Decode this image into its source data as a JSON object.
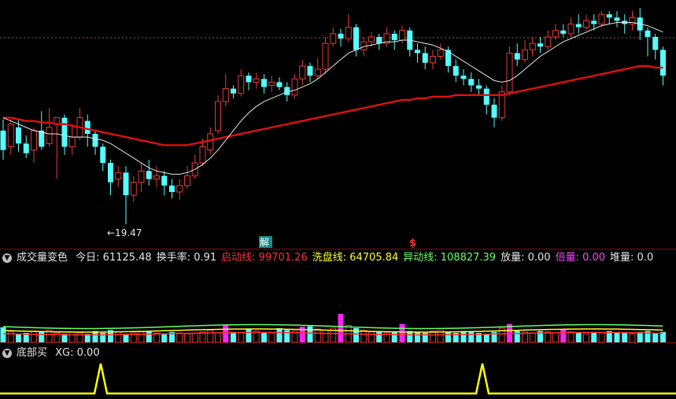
{
  "main_chart": {
    "min_price_label": "←19.47",
    "signal_jie": "解",
    "signal_s": "$"
  },
  "volume_panel": {
    "title": "成交量变色",
    "items": [
      {
        "label": "今日:",
        "value": "61125.48",
        "color": "#e6e6e6"
      },
      {
        "label": "换手率:",
        "value": "0.91",
        "color": "#e6e6e6"
      },
      {
        "label": "启动线:",
        "value": "99701.26",
        "color": "#ff3030"
      },
      {
        "label": "洗盘线:",
        "value": "64705.84",
        "color": "#ffff33"
      },
      {
        "label": "异动线:",
        "value": "108827.39",
        "color": "#66ff66"
      },
      {
        "label": "放量:",
        "value": "0.00",
        "color": "#e6e6e6"
      },
      {
        "label": "倍量:",
        "value": "0.00",
        "color": "#ff44ff"
      },
      {
        "label": "堆量:",
        "value": "0.0",
        "color": "#e6e6e6"
      }
    ]
  },
  "bottom_panel": {
    "title": "底部买",
    "xg_label": "XG: 0.00"
  },
  "colors": {
    "up": "#e83a3a",
    "down": "#54ffff",
    "ma_long": "#e01010",
    "ma_short": "#e6e6e6",
    "signal": "#ffff00"
  },
  "chart_data": {
    "type": "candlestick",
    "candles": [
      [
        0.7,
        0.58,
        0.52,
        0.77
      ],
      [
        0.6,
        0.74,
        0.55,
        0.77
      ],
      [
        0.72,
        0.62,
        0.57,
        0.77
      ],
      [
        0.62,
        0.56,
        0.53,
        0.67
      ],
      [
        0.58,
        0.7,
        0.5,
        0.72
      ],
      [
        0.7,
        0.6,
        0.58,
        0.82
      ],
      [
        0.62,
        0.72,
        0.6,
        0.84
      ],
      [
        0.74,
        0.78,
        0.4,
        0.78
      ],
      [
        0.78,
        0.6,
        0.55,
        0.8
      ],
      [
        0.6,
        0.66,
        0.55,
        0.74
      ],
      [
        0.66,
        0.78,
        0.64,
        0.84
      ],
      [
        0.76,
        0.68,
        0.6,
        0.8
      ],
      [
        0.68,
        0.6,
        0.55,
        0.7
      ],
      [
        0.6,
        0.5,
        0.45,
        0.62
      ],
      [
        0.5,
        0.38,
        0.3,
        0.52
      ],
      [
        0.4,
        0.44,
        0.35,
        0.48
      ],
      [
        0.44,
        0.3,
        0.12,
        0.48
      ],
      [
        0.3,
        0.38,
        0.26,
        0.42
      ],
      [
        0.38,
        0.45,
        0.32,
        0.5
      ],
      [
        0.45,
        0.4,
        0.36,
        0.52
      ],
      [
        0.4,
        0.42,
        0.35,
        0.48
      ],
      [
        0.42,
        0.36,
        0.3,
        0.45
      ],
      [
        0.36,
        0.32,
        0.28,
        0.4
      ],
      [
        0.32,
        0.36,
        0.27,
        0.4
      ],
      [
        0.36,
        0.42,
        0.34,
        0.48
      ],
      [
        0.42,
        0.5,
        0.4,
        0.55
      ],
      [
        0.5,
        0.6,
        0.48,
        0.65
      ],
      [
        0.58,
        0.68,
        0.55,
        0.72
      ],
      [
        0.7,
        0.88,
        0.68,
        0.92
      ],
      [
        0.88,
        0.96,
        0.85,
        1.05
      ],
      [
        0.96,
        0.93,
        0.9,
        0.98
      ],
      [
        0.93,
        1.04,
        0.91,
        1.08
      ],
      [
        1.04,
        1.0,
        0.95,
        1.06
      ],
      [
        1.0,
        1.02,
        0.96,
        1.06
      ],
      [
        1.02,
        0.97,
        0.93,
        1.05
      ],
      [
        0.98,
        1.0,
        0.94,
        1.04
      ],
      [
        1.0,
        0.97,
        0.95,
        1.03
      ],
      [
        0.97,
        0.92,
        0.88,
        1.0
      ],
      [
        0.92,
        1.02,
        0.9,
        1.05
      ],
      [
        1.02,
        1.1,
        0.98,
        1.14
      ],
      [
        1.1,
        1.04,
        1.0,
        1.12
      ],
      [
        1.04,
        1.08,
        1.02,
        1.15
      ],
      [
        1.08,
        1.24,
        1.05,
        1.28
      ],
      [
        1.24,
        1.3,
        1.22,
        1.34
      ],
      [
        1.3,
        1.27,
        1.22,
        1.33
      ],
      [
        1.27,
        1.34,
        1.25,
        1.42
      ],
      [
        1.34,
        1.2,
        1.16,
        1.36
      ],
      [
        1.2,
        1.25,
        1.16,
        1.28
      ],
      [
        1.25,
        1.28,
        1.22,
        1.31
      ],
      [
        1.28,
        1.24,
        1.2,
        1.3
      ],
      [
        1.24,
        1.3,
        1.22,
        1.34
      ],
      [
        1.3,
        1.26,
        1.2,
        1.32
      ],
      [
        1.26,
        1.32,
        1.24,
        1.35
      ],
      [
        1.32,
        1.2,
        1.16,
        1.34
      ],
      [
        1.2,
        1.18,
        1.12,
        1.24
      ],
      [
        1.18,
        1.12,
        1.08,
        1.22
      ],
      [
        1.12,
        1.16,
        1.08,
        1.2
      ],
      [
        1.16,
        1.2,
        1.14,
        1.24
      ],
      [
        1.2,
        1.1,
        1.06,
        1.22
      ],
      [
        1.1,
        1.04,
        1.0,
        1.14
      ],
      [
        1.04,
        1.02,
        0.98,
        1.08
      ],
      [
        1.02,
        0.98,
        0.94,
        1.06
      ],
      [
        0.98,
        0.96,
        0.92,
        1.02
      ],
      [
        0.96,
        0.86,
        0.8,
        0.98
      ],
      [
        0.86,
        0.78,
        0.72,
        0.9
      ],
      [
        0.78,
        0.94,
        0.76,
        0.98
      ],
      [
        0.94,
        1.18,
        0.92,
        1.22
      ],
      [
        1.18,
        1.14,
        1.1,
        1.24
      ],
      [
        1.14,
        1.2,
        1.12,
        1.26
      ],
      [
        1.2,
        1.24,
        1.16,
        1.28
      ],
      [
        1.24,
        1.22,
        1.18,
        1.28
      ],
      [
        1.22,
        1.28,
        1.2,
        1.32
      ],
      [
        1.28,
        1.32,
        1.26,
        1.36
      ],
      [
        1.32,
        1.3,
        1.28,
        1.36
      ],
      [
        1.3,
        1.36,
        1.28,
        1.4
      ],
      [
        1.36,
        1.34,
        1.3,
        1.42
      ],
      [
        1.34,
        1.38,
        1.32,
        1.42
      ],
      [
        1.38,
        1.36,
        1.32,
        1.42
      ],
      [
        1.36,
        1.42,
        1.34,
        1.44
      ],
      [
        1.42,
        1.4,
        1.36,
        1.44
      ],
      [
        1.4,
        1.38,
        1.34,
        1.44
      ],
      [
        1.38,
        1.36,
        1.3,
        1.42
      ],
      [
        1.36,
        1.4,
        1.32,
        1.44
      ],
      [
        1.4,
        1.32,
        1.26,
        1.46
      ],
      [
        1.32,
        1.28,
        1.16,
        1.34
      ],
      [
        1.28,
        1.2,
        1.14,
        1.3
      ],
      [
        1.2,
        1.04,
        0.98,
        1.22
      ]
    ],
    "ma_short": [
      0.78,
      0.76,
      0.74,
      0.72,
      0.7,
      0.69,
      0.68,
      0.68,
      0.67,
      0.66,
      0.66,
      0.66,
      0.65,
      0.64,
      0.62,
      0.59,
      0.56,
      0.53,
      0.5,
      0.47,
      0.45,
      0.44,
      0.43,
      0.43,
      0.44,
      0.46,
      0.49,
      0.53,
      0.58,
      0.64,
      0.7,
      0.76,
      0.81,
      0.85,
      0.88,
      0.9,
      0.92,
      0.94,
      0.95,
      0.97,
      0.99,
      1.02,
      1.06,
      1.1,
      1.14,
      1.18,
      1.2,
      1.22,
      1.23,
      1.24,
      1.25,
      1.25,
      1.26,
      1.26,
      1.25,
      1.24,
      1.23,
      1.21,
      1.19,
      1.16,
      1.13,
      1.1,
      1.07,
      1.04,
      1.01,
      1.0,
      1.01,
      1.04,
      1.08,
      1.12,
      1.16,
      1.19,
      1.22,
      1.25,
      1.27,
      1.29,
      1.31,
      1.33,
      1.35,
      1.36,
      1.37,
      1.37,
      1.37,
      1.36,
      1.35,
      1.33,
      1.31
    ],
    "ma_long": [
      0.78,
      0.78,
      0.77,
      0.76,
      0.76,
      0.75,
      0.75,
      0.74,
      0.74,
      0.73,
      0.72,
      0.71,
      0.7,
      0.69,
      0.68,
      0.67,
      0.66,
      0.65,
      0.64,
      0.63,
      0.62,
      0.61,
      0.61,
      0.61,
      0.61,
      0.62,
      0.63,
      0.64,
      0.65,
      0.66,
      0.67,
      0.68,
      0.69,
      0.7,
      0.71,
      0.72,
      0.73,
      0.74,
      0.75,
      0.76,
      0.77,
      0.78,
      0.79,
      0.8,
      0.81,
      0.82,
      0.83,
      0.84,
      0.85,
      0.86,
      0.87,
      0.88,
      0.89,
      0.89,
      0.9,
      0.9,
      0.91,
      0.91,
      0.91,
      0.92,
      0.92,
      0.92,
      0.92,
      0.92,
      0.92,
      0.92,
      0.93,
      0.94,
      0.95,
      0.96,
      0.97,
      0.98,
      0.99,
      1.0,
      1.01,
      1.02,
      1.03,
      1.04,
      1.05,
      1.06,
      1.07,
      1.08,
      1.09,
      1.1,
      1.1,
      1.09,
      1.09
    ],
    "volume": [
      32,
      22,
      18,
      20,
      24,
      22,
      26,
      20,
      18,
      22,
      20,
      18,
      24,
      20,
      26,
      22,
      18,
      20,
      22,
      24,
      20,
      18,
      22,
      20,
      18,
      20,
      22,
      26,
      20,
      24,
      22,
      20,
      28,
      24,
      22,
      20,
      30,
      26,
      24,
      22,
      34,
      28,
      26,
      30,
      40,
      36,
      30,
      26,
      22,
      24,
      20,
      22,
      26,
      24,
      22,
      20,
      24,
      26,
      22,
      20,
      24,
      22,
      20,
      18,
      22,
      30,
      26,
      24,
      22,
      20,
      24,
      22,
      20,
      18,
      22,
      20,
      18,
      22,
      20,
      24,
      22,
      20,
      18,
      22,
      24,
      20,
      22
    ],
    "volume_highlight": [
      29,
      39,
      44,
      52,
      66,
      73
    ],
    "signal_x": [
      128,
      613
    ]
  }
}
